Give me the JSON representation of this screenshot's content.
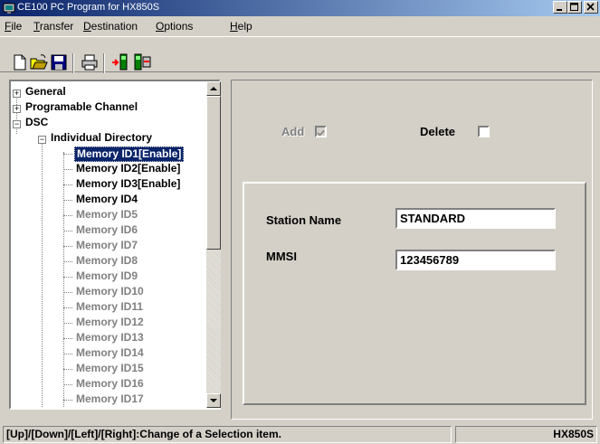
{
  "window": {
    "title": "CE100  PC Program for HX850S",
    "buttons": [
      "minimize",
      "maximize",
      "close"
    ]
  },
  "menu": [
    "File",
    "Transfer",
    "Destination",
    "Options",
    "Help"
  ],
  "toolbar": {
    "icons": [
      "new-file-icon",
      "open-folder-icon",
      "save-disk-icon",
      "print-icon",
      "transfer-to-radio-icon",
      "transfer-from-radio-icon"
    ]
  },
  "tree": {
    "items": [
      {
        "label": "General",
        "expander": "+"
      },
      {
        "label": "Programable Channel",
        "expander": "+"
      },
      {
        "label": "DSC",
        "expander": "−"
      },
      {
        "label": "Individual Directory",
        "expander": "−"
      },
      {
        "label": "Memory ID1[Enable]",
        "state": "selected"
      },
      {
        "label": "Memory ID2[Enable]"
      },
      {
        "label": "Memory ID3[Enable]"
      },
      {
        "label": "Memory ID4"
      },
      {
        "label": "Memory ID5",
        "state": "disabled"
      },
      {
        "label": "Memory ID6",
        "state": "disabled"
      },
      {
        "label": "Memory ID7",
        "state": "disabled"
      },
      {
        "label": "Memory ID8",
        "state": "disabled"
      },
      {
        "label": "Memory ID9",
        "state": "disabled"
      },
      {
        "label": "Memory ID10",
        "state": "disabled"
      },
      {
        "label": "Memory ID11",
        "state": "disabled"
      },
      {
        "label": "Memory ID12",
        "state": "disabled"
      },
      {
        "label": "Memory ID13",
        "state": "disabled"
      },
      {
        "label": "Memory ID14",
        "state": "disabled"
      },
      {
        "label": "Memory ID15",
        "state": "disabled"
      },
      {
        "label": "Memory ID16",
        "state": "disabled"
      },
      {
        "label": "Memory ID17",
        "state": "disabled"
      }
    ]
  },
  "form": {
    "add_label": "Add",
    "add_checked": true,
    "delete_label": "Delete",
    "delete_checked": false,
    "station_name_label": "Station Name",
    "station_name_value": "STANDARD",
    "mmsi_label": "MMSI",
    "mmsi_value": "123456789"
  },
  "status": {
    "hint": "[Up]/[Down]/[Left]/[Right]:Change of a Selection item.",
    "model": "HX850S"
  },
  "colors": {
    "title_active": "#0a246a",
    "face": "#d4d0c8",
    "selection": "#0a246a",
    "disabled_text": "#808080"
  }
}
